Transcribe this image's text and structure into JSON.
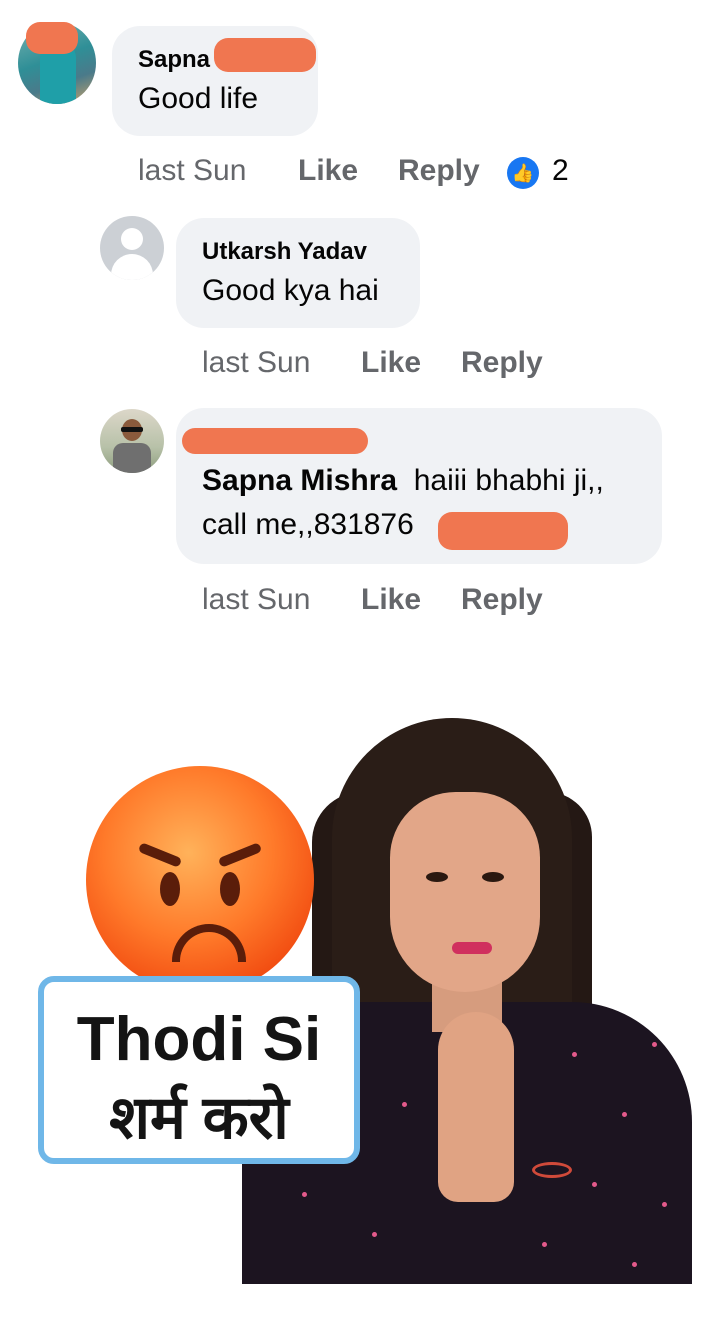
{
  "comments": [
    {
      "author": "Sapna",
      "text": "Good life",
      "time": "last Sun",
      "like_label": "Like",
      "reply_label": "Reply",
      "reaction_count": "2",
      "reaction_icon": "thumbs-up-icon"
    },
    {
      "author": "Utkarsh Yadav",
      "text": "Good kya hai",
      "time": "last Sun",
      "like_label": "Like",
      "reply_label": "Reply"
    },
    {
      "author": "",
      "mention": "Sapna Mishra",
      "text_line1": "haiii bhabhi ji,,",
      "text_line2": "call me,,831876",
      "time": "last Sun",
      "like_label": "Like",
      "reply_label": "Reply"
    }
  ],
  "meme": {
    "line1": "Thodi Si",
    "line2": "शर्म करो",
    "emoji": "angry-face-emoji"
  },
  "colors": {
    "bubble": "#f0f2f5",
    "meta_text": "#65676b",
    "reaction_blue": "#1877f2",
    "redaction": "#f07650",
    "caption_border": "#6fb7e8"
  }
}
